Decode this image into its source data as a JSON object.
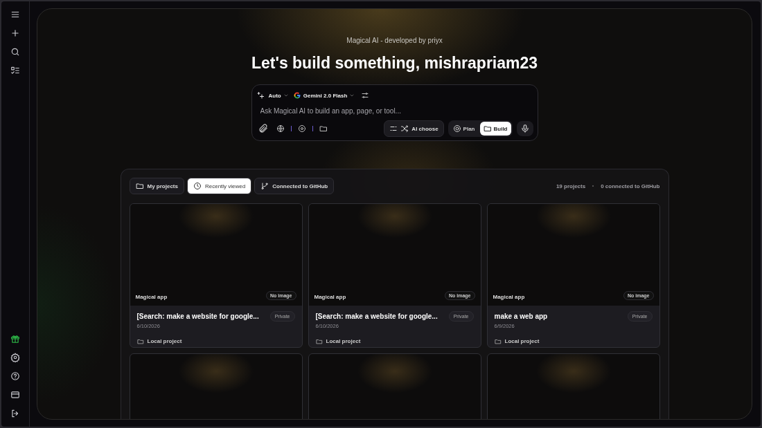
{
  "sidebar": {
    "top_items": [
      {
        "kind": "menu"
      },
      {
        "kind": "new"
      },
      {
        "kind": "search"
      },
      {
        "kind": "tasks"
      }
    ],
    "bottom_items": [
      {
        "kind": "gift"
      },
      {
        "kind": "settings"
      },
      {
        "kind": "help"
      },
      {
        "kind": "billing"
      },
      {
        "kind": "logout"
      }
    ]
  },
  "header": {
    "subtitle": "Magical AI - developed by priyx",
    "title": "Let's build something, mishrapriam23"
  },
  "prompt": {
    "mode": "Auto",
    "model": "Gemini 2.0 Flash",
    "placeholder": "Ask Magical AI to build an app, page, or tool...",
    "ai_choose": "AI choose",
    "modes": [
      {
        "label": "Plan",
        "selected": false
      },
      {
        "label": "Build",
        "selected": true
      }
    ]
  },
  "projects": {
    "tabs": [
      {
        "label": "My projects",
        "selected": false
      },
      {
        "label": "Recently viewed",
        "selected": true
      },
      {
        "label": "Connected to GitHub",
        "selected": false
      }
    ],
    "count": "19 projects",
    "connected": "0 connected to GitHub",
    "cards": [
      {
        "kind": "full",
        "app": "Magical app",
        "image_badge": "No image",
        "title": "[Search: make a website for google...",
        "visibility": "Private",
        "date": "6/10/2026",
        "location": "Local project"
      },
      {
        "kind": "full",
        "app": "Magical app",
        "image_badge": "No image",
        "title": "[Search: make a website for google...",
        "visibility": "Private",
        "date": "6/10/2026",
        "location": "Local project"
      },
      {
        "kind": "full",
        "app": "Magical app",
        "image_badge": "No image",
        "title": "make a web app",
        "visibility": "Private",
        "date": "6/9/2026",
        "location": "Local project"
      },
      {
        "kind": "preview"
      },
      {
        "kind": "preview"
      },
      {
        "kind": "preview"
      }
    ]
  }
}
